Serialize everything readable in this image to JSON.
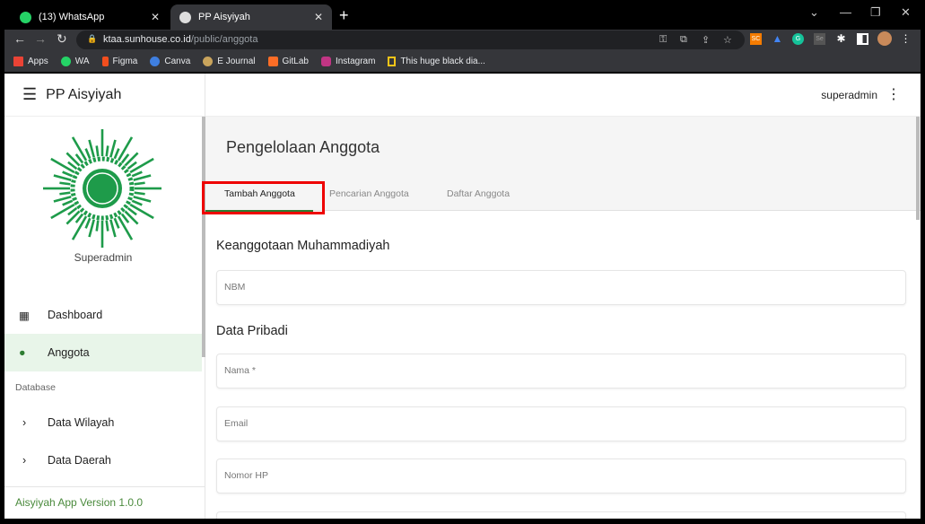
{
  "browser": {
    "tabs": [
      {
        "label": "(13) WhatsApp",
        "icon": "whatsapp-icon"
      },
      {
        "label": "PP Aisyiyah",
        "icon": "globe-icon"
      }
    ],
    "url_host": "ktaa.sunhouse.co.id",
    "url_path": "/public/anggota",
    "extensions": [
      "SC",
      "Se"
    ],
    "bookmarks": [
      {
        "label": "Apps",
        "color": "#ea4335"
      },
      {
        "label": "WA",
        "color": "#25d366"
      },
      {
        "label": "Figma",
        "color": "#f24e1e"
      },
      {
        "label": "Canva",
        "color": "#3f7fe0"
      },
      {
        "label": "E Journal",
        "color": "#c9a45c"
      },
      {
        "label": "GitLab",
        "color": "#fc6d26"
      },
      {
        "label": "Instagram",
        "color": "#c13584"
      },
      {
        "label": "This huge black dia...",
        "color": "#f5c518"
      }
    ]
  },
  "app": {
    "title": "PP Aisyiyah",
    "role": "Superadmin",
    "user": "superadmin",
    "accent": "#2e7d32",
    "menu": [
      {
        "label": "Dashboard",
        "icon": "dashboard-icon"
      },
      {
        "label": "Anggota",
        "icon": "person-icon",
        "active": true
      }
    ],
    "section": "Database",
    "db_menu": [
      {
        "label": "Data Wilayah"
      },
      {
        "label": "Data Daerah"
      }
    ],
    "version": "Aisyiyah App Version 1.0.0"
  },
  "main": {
    "title": "Pengelolaan Anggota",
    "tabs": [
      {
        "label": "Tambah Anggota",
        "active": true
      },
      {
        "label": "Pencarian Anggota"
      },
      {
        "label": "Daftar Anggota"
      }
    ],
    "sections": [
      {
        "title": "Keanggotaan Muhammadiyah"
      },
      {
        "title": "Data Pribadi"
      }
    ],
    "fields": [
      {
        "placeholder": "NBM"
      },
      {
        "placeholder": "Nama *"
      },
      {
        "placeholder": "Email"
      },
      {
        "placeholder": "Nomor HP"
      }
    ]
  }
}
